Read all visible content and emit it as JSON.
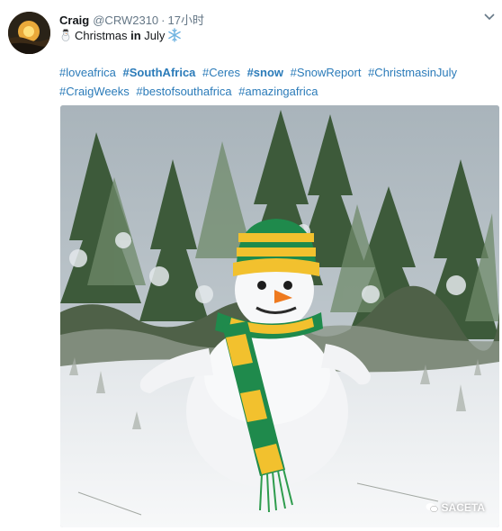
{
  "tweet": {
    "author_name": "Craig",
    "handle": "@CRW2310",
    "separator": "·",
    "time": "17小时",
    "text_pre": "Christmas ",
    "text_bold": "in",
    "text_post": " July",
    "hashtags": [
      {
        "text": "#loveafrica",
        "bold": false
      },
      {
        "text": "#SouthAfrica",
        "bold": true
      },
      {
        "text": "#Ceres",
        "bold": false
      },
      {
        "text": "#snow",
        "bold": true
      },
      {
        "text": "#SnowReport",
        "bold": false
      },
      {
        "text": "#ChristmasinJuly",
        "bold": false
      },
      {
        "text": "#CraigWeeks",
        "bold": false
      },
      {
        "text": "#bestofsouthafrica",
        "bold": false
      },
      {
        "text": "#amazingafrica",
        "bold": false
      }
    ],
    "watermark": "SACETA"
  },
  "icons": {
    "more": "chevron-down-icon",
    "snowman": "snowman-emoji-icon",
    "snowflake": "snowflake-emoji-icon",
    "watermark": "wechat-logo-icon"
  },
  "colors": {
    "link": "#2b7bb9",
    "text": "#14171a",
    "muted": "#657786",
    "scarf_green": "#1f8a4c",
    "scarf_yellow": "#f2c12e"
  }
}
